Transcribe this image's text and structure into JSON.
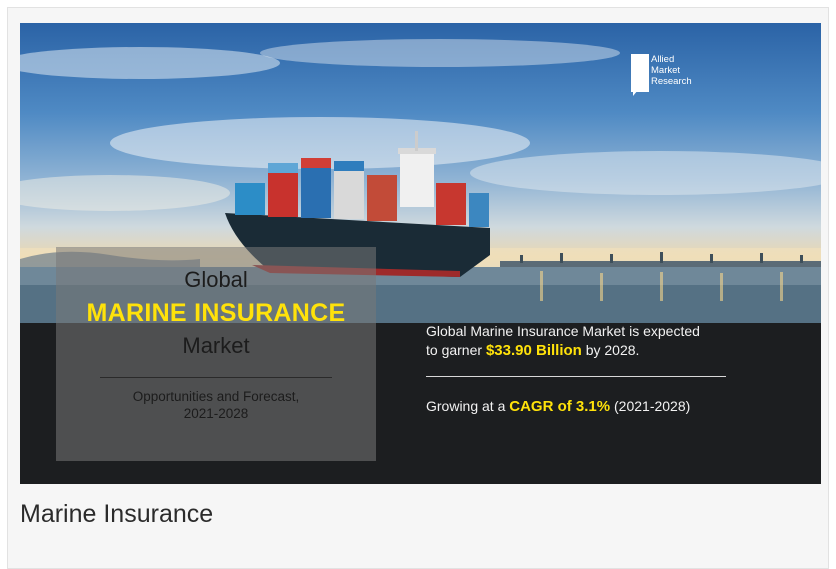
{
  "banner": {
    "logo": {
      "line1": "Allied",
      "line2": "Market",
      "line3": "Research"
    },
    "title": {
      "prefix": "Global",
      "main": "MARINE INSURANCE",
      "suffix": "Market"
    },
    "subtitle": {
      "line1": "Opportunities and Forecast,",
      "line2": "2021-2028"
    },
    "stat_market": {
      "line1": "Global Marine Insurance Market is expected",
      "prefix": "to garner ",
      "value": "$33.90 Billion",
      "suffix": " by 2028."
    },
    "stat_cagr": {
      "prefix": "Growing at a ",
      "value": "CAGR of 3.1%",
      "suffix": " (2021-2028)"
    }
  },
  "caption": "Marine Insurance",
  "colors": {
    "accent": "#ffe20a",
    "dark": "#1c1e20"
  }
}
